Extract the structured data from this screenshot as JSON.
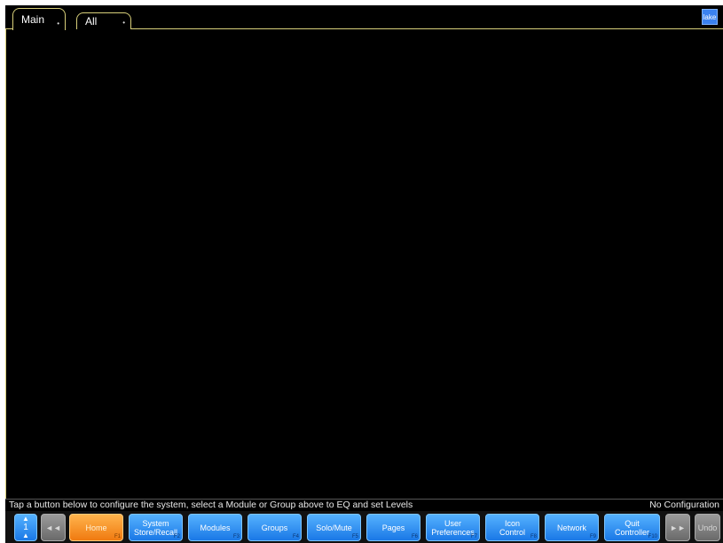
{
  "tabs": [
    {
      "label": "Main",
      "active": true
    },
    {
      "label": "All",
      "active": false
    }
  ],
  "logo": {
    "text": "lake",
    "color": "#3b82f0"
  },
  "status": {
    "message": "Tap a button below to configure the system, select a Module or Group above to EQ and set Levels",
    "config": "No Configuration"
  },
  "toolbar": {
    "page_number": "1",
    "prev_label": "◄◄",
    "home": {
      "label": "Home",
      "fkey": "F1"
    },
    "system_store_recall": {
      "line1": "System",
      "line2": "Store/Recall",
      "fkey": "F2"
    },
    "modules": {
      "label": "Modules",
      "fkey": "F3"
    },
    "groups": {
      "label": "Groups",
      "fkey": "F4"
    },
    "solo_mute": {
      "label": "Solo/Mute",
      "fkey": "F5"
    },
    "pages": {
      "label": "Pages",
      "fkey": "F6"
    },
    "user_preferences": {
      "line1": "User",
      "line2": "Preferences",
      "fkey": "F7"
    },
    "icon_control": {
      "line1": "Icon",
      "line2": "Control",
      "fkey": "F8"
    },
    "network": {
      "label": "Network",
      "fkey": "F9"
    },
    "quit_controller": {
      "line1": "Quit",
      "line2": "Controller",
      "fkey": "F10"
    },
    "next_label": "►►",
    "undo_label": "Undo"
  },
  "colors": {
    "accent_blue": "#1a78e6",
    "home_orange": "#f07a10",
    "tab_outline": "#d8cf7a",
    "background": "#000000"
  }
}
